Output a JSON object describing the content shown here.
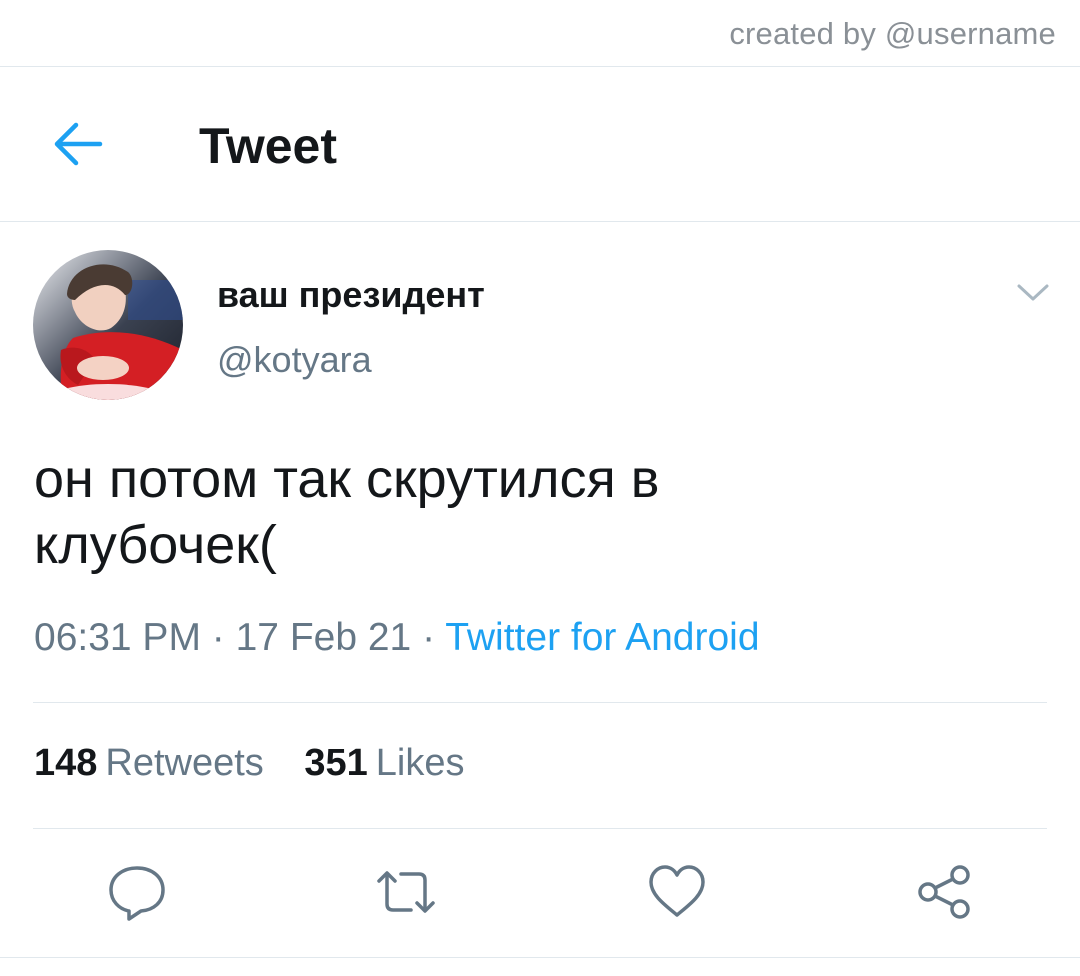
{
  "credit": {
    "text": "created by @username"
  },
  "header": {
    "title": "Tweet",
    "back_icon": "arrow-left-icon"
  },
  "tweet": {
    "display_name": "ваш президент",
    "handle": "@kotyara",
    "avatar_icon": "profile-photo",
    "text": "он потом так скрутился в\nклубочек(",
    "time": "06:31 PM",
    "date": "17 Feb 21",
    "source": "Twitter for Android",
    "separator": " · "
  },
  "stats": {
    "retweets_count": "148",
    "retweets_label": "Retweets",
    "likes_count": "351",
    "likes_label": "Likes"
  },
  "actions": [
    "reply-icon",
    "retweet-icon",
    "like-icon",
    "share-icon"
  ],
  "colors": {
    "accent": "#1da1f2",
    "text": "#14171a",
    "muted": "#657786",
    "icon": "#657786",
    "divider": "#e1e8ed"
  }
}
